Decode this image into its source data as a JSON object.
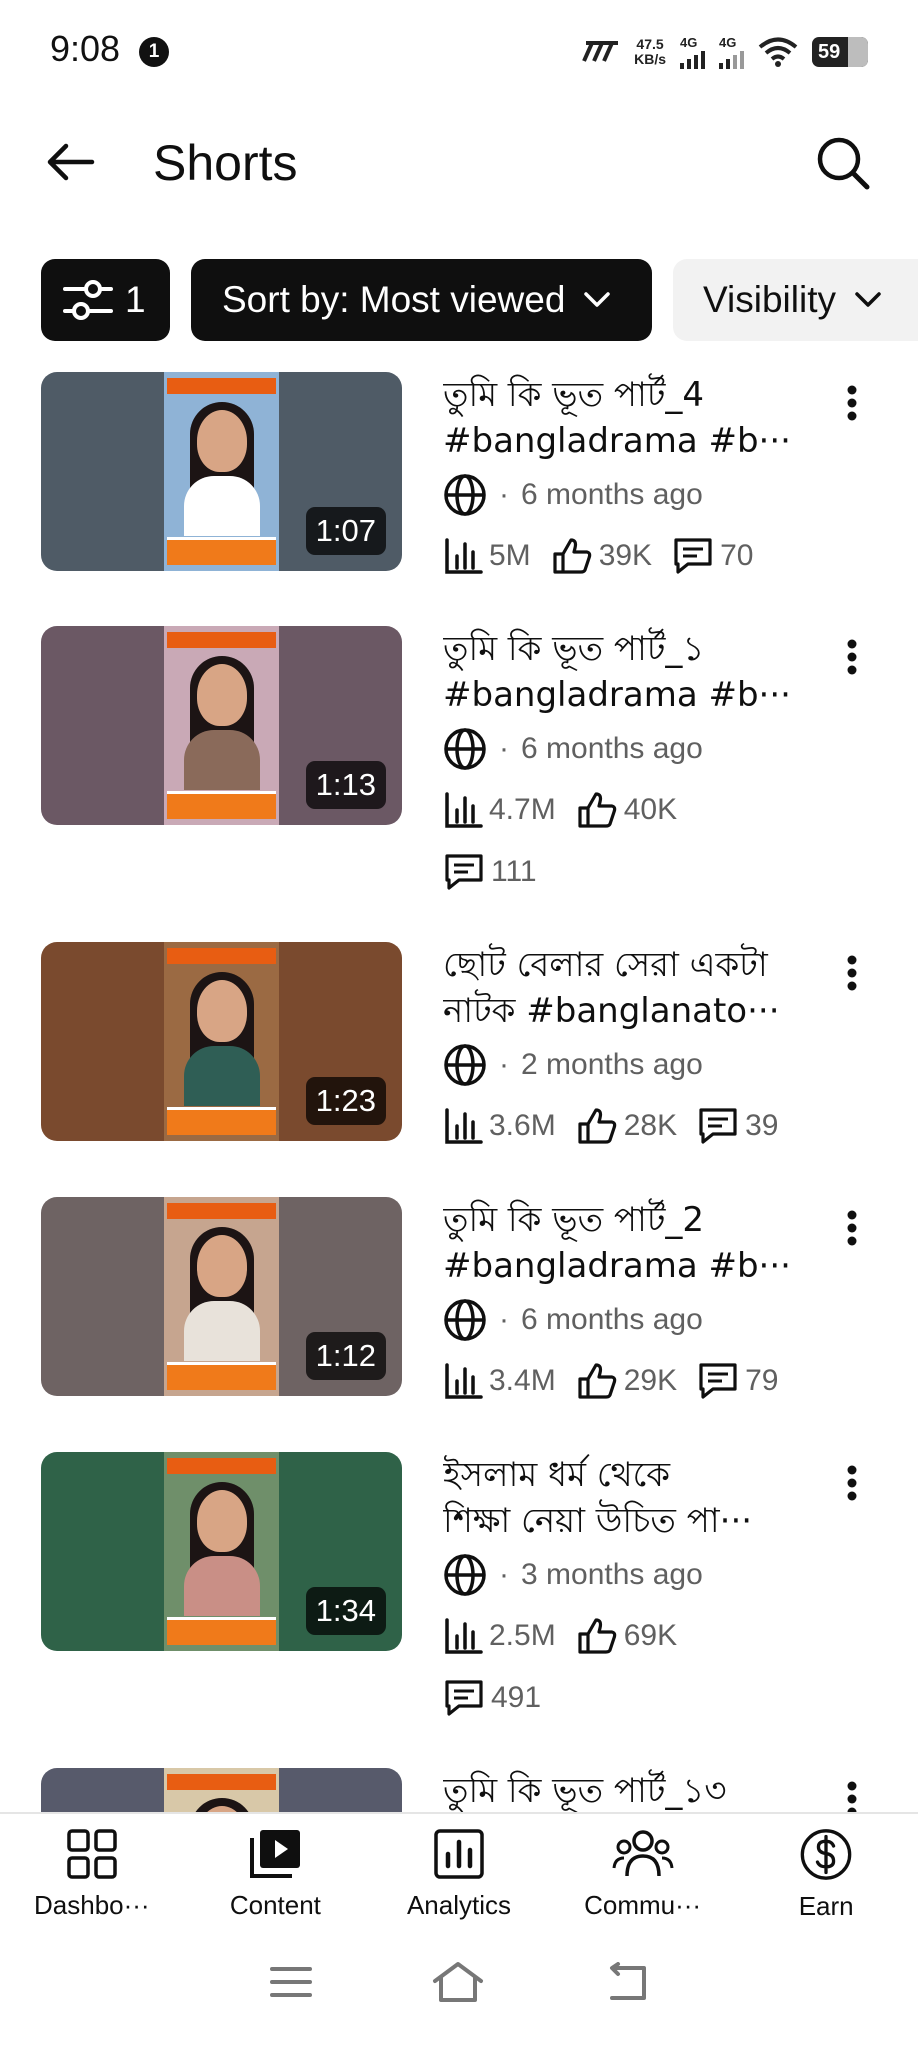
{
  "status_bar": {
    "time": "9:08",
    "notification_count": "1",
    "speed_value": "47.5",
    "speed_unit": "KB/s",
    "network_1": "4G",
    "network_2": "4G",
    "battery": "59"
  },
  "header": {
    "title": "Shorts",
    "back_icon": "arrow-left-icon",
    "search_icon": "search-icon"
  },
  "filters": {
    "filter_count": "1",
    "sort_label": "Sort by: Most viewed",
    "visibility_label": "Visibility"
  },
  "videos": [
    {
      "title_line1": "তুমি কি ভূত পার্ট_4",
      "title_line2": "#bangladrama #b···",
      "duration": "1:07",
      "age": "6 months ago",
      "views": "5M",
      "likes": "39K",
      "comments": "70",
      "bg": "#4f5b66",
      "poster_bg": "#8fb3d6",
      "body_color": "#ffffff"
    },
    {
      "title_line1": "তুমি কি ভূত পার্ট_১",
      "title_line2": "#bangladrama #b···",
      "duration": "1:13",
      "age": "6 months ago",
      "views": "4.7M",
      "likes": "40K",
      "comments": "111",
      "bg": "#6b5864",
      "poster_bg": "#c9a9b6",
      "body_color": "#8a6a5a"
    },
    {
      "title_line1": "ছোট বেলার সেরা একটা",
      "title_line2": "নাটক #banglanato···",
      "duration": "1:23",
      "age": "2 months ago",
      "views": "3.6M",
      "likes": "28K",
      "comments": "39",
      "bg": "#7a4a2e",
      "poster_bg": "#9b6a43",
      "body_color": "#2f5e55"
    },
    {
      "title_line1": "তুমি কি ভূত পার্ট_2",
      "title_line2": "#bangladrama #b···",
      "duration": "1:12",
      "age": "6 months ago",
      "views": "3.4M",
      "likes": "29K",
      "comments": "79",
      "bg": "#6e6363",
      "poster_bg": "#c6a58f",
      "body_color": "#e8e2da"
    },
    {
      "title_line1": "ইসলাম ধর্ম থেকে",
      "title_line2": "শিক্ষা নেয়া উচিত পা···",
      "duration": "1:34",
      "age": "3 months ago",
      "views": "2.5M",
      "likes": "69K",
      "comments": "491",
      "bg": "#2f6248",
      "poster_bg": "#6f8f6a",
      "body_color": "#c98f86"
    },
    {
      "title_line1": "তুমি কি ভূত পার্ট_১৩",
      "bg": "#575a6b",
      "poster_bg": "#d8c8a8",
      "body_color": "#ffffff"
    }
  ],
  "bottom_nav": [
    {
      "label": "Dashbo···",
      "icon": "dashboard-icon"
    },
    {
      "label": "Content",
      "icon": "content-icon"
    },
    {
      "label": "Analytics",
      "icon": "analytics-icon"
    },
    {
      "label": "Commu···",
      "icon": "community-icon"
    },
    {
      "label": "Earn",
      "icon": "earn-icon"
    }
  ],
  "system_nav": {
    "menu_icon": "menu-icon",
    "home_icon": "home-icon",
    "back_icon": "back-icon"
  }
}
